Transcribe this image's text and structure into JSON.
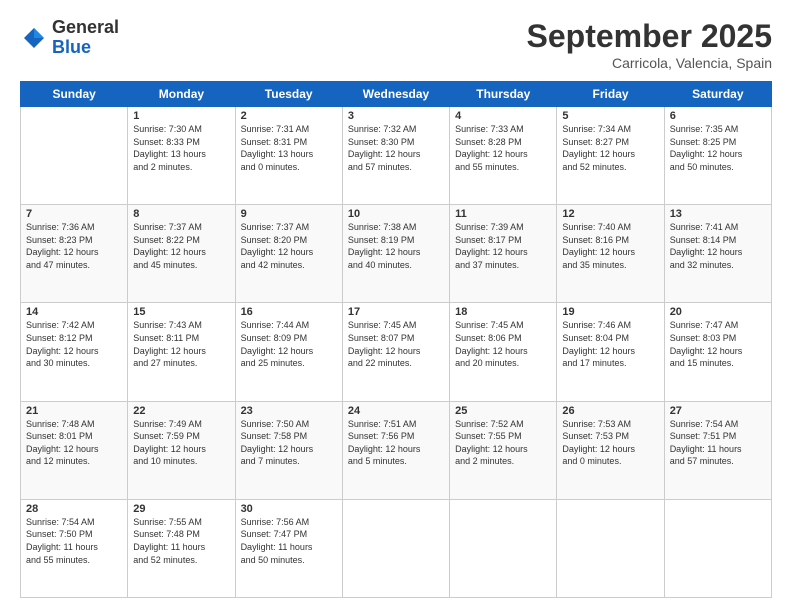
{
  "logo": {
    "general": "General",
    "blue": "Blue"
  },
  "title": "September 2025",
  "location": "Carricola, Valencia, Spain",
  "days_of_week": [
    "Sunday",
    "Monday",
    "Tuesday",
    "Wednesday",
    "Thursday",
    "Friday",
    "Saturday"
  ],
  "weeks": [
    [
      {
        "num": "",
        "info": ""
      },
      {
        "num": "1",
        "info": "Sunrise: 7:30 AM\nSunset: 8:33 PM\nDaylight: 13 hours\nand 2 minutes."
      },
      {
        "num": "2",
        "info": "Sunrise: 7:31 AM\nSunset: 8:31 PM\nDaylight: 13 hours\nand 0 minutes."
      },
      {
        "num": "3",
        "info": "Sunrise: 7:32 AM\nSunset: 8:30 PM\nDaylight: 12 hours\nand 57 minutes."
      },
      {
        "num": "4",
        "info": "Sunrise: 7:33 AM\nSunset: 8:28 PM\nDaylight: 12 hours\nand 55 minutes."
      },
      {
        "num": "5",
        "info": "Sunrise: 7:34 AM\nSunset: 8:27 PM\nDaylight: 12 hours\nand 52 minutes."
      },
      {
        "num": "6",
        "info": "Sunrise: 7:35 AM\nSunset: 8:25 PM\nDaylight: 12 hours\nand 50 minutes."
      }
    ],
    [
      {
        "num": "7",
        "info": "Sunrise: 7:36 AM\nSunset: 8:23 PM\nDaylight: 12 hours\nand 47 minutes."
      },
      {
        "num": "8",
        "info": "Sunrise: 7:37 AM\nSunset: 8:22 PM\nDaylight: 12 hours\nand 45 minutes."
      },
      {
        "num": "9",
        "info": "Sunrise: 7:37 AM\nSunset: 8:20 PM\nDaylight: 12 hours\nand 42 minutes."
      },
      {
        "num": "10",
        "info": "Sunrise: 7:38 AM\nSunset: 8:19 PM\nDaylight: 12 hours\nand 40 minutes."
      },
      {
        "num": "11",
        "info": "Sunrise: 7:39 AM\nSunset: 8:17 PM\nDaylight: 12 hours\nand 37 minutes."
      },
      {
        "num": "12",
        "info": "Sunrise: 7:40 AM\nSunset: 8:16 PM\nDaylight: 12 hours\nand 35 minutes."
      },
      {
        "num": "13",
        "info": "Sunrise: 7:41 AM\nSunset: 8:14 PM\nDaylight: 12 hours\nand 32 minutes."
      }
    ],
    [
      {
        "num": "14",
        "info": "Sunrise: 7:42 AM\nSunset: 8:12 PM\nDaylight: 12 hours\nand 30 minutes."
      },
      {
        "num": "15",
        "info": "Sunrise: 7:43 AM\nSunset: 8:11 PM\nDaylight: 12 hours\nand 27 minutes."
      },
      {
        "num": "16",
        "info": "Sunrise: 7:44 AM\nSunset: 8:09 PM\nDaylight: 12 hours\nand 25 minutes."
      },
      {
        "num": "17",
        "info": "Sunrise: 7:45 AM\nSunset: 8:07 PM\nDaylight: 12 hours\nand 22 minutes."
      },
      {
        "num": "18",
        "info": "Sunrise: 7:45 AM\nSunset: 8:06 PM\nDaylight: 12 hours\nand 20 minutes."
      },
      {
        "num": "19",
        "info": "Sunrise: 7:46 AM\nSunset: 8:04 PM\nDaylight: 12 hours\nand 17 minutes."
      },
      {
        "num": "20",
        "info": "Sunrise: 7:47 AM\nSunset: 8:03 PM\nDaylight: 12 hours\nand 15 minutes."
      }
    ],
    [
      {
        "num": "21",
        "info": "Sunrise: 7:48 AM\nSunset: 8:01 PM\nDaylight: 12 hours\nand 12 minutes."
      },
      {
        "num": "22",
        "info": "Sunrise: 7:49 AM\nSunset: 7:59 PM\nDaylight: 12 hours\nand 10 minutes."
      },
      {
        "num": "23",
        "info": "Sunrise: 7:50 AM\nSunset: 7:58 PM\nDaylight: 12 hours\nand 7 minutes."
      },
      {
        "num": "24",
        "info": "Sunrise: 7:51 AM\nSunset: 7:56 PM\nDaylight: 12 hours\nand 5 minutes."
      },
      {
        "num": "25",
        "info": "Sunrise: 7:52 AM\nSunset: 7:55 PM\nDaylight: 12 hours\nand 2 minutes."
      },
      {
        "num": "26",
        "info": "Sunrise: 7:53 AM\nSunset: 7:53 PM\nDaylight: 12 hours\nand 0 minutes."
      },
      {
        "num": "27",
        "info": "Sunrise: 7:54 AM\nSunset: 7:51 PM\nDaylight: 11 hours\nand 57 minutes."
      }
    ],
    [
      {
        "num": "28",
        "info": "Sunrise: 7:54 AM\nSunset: 7:50 PM\nDaylight: 11 hours\nand 55 minutes."
      },
      {
        "num": "29",
        "info": "Sunrise: 7:55 AM\nSunset: 7:48 PM\nDaylight: 11 hours\nand 52 minutes."
      },
      {
        "num": "30",
        "info": "Sunrise: 7:56 AM\nSunset: 7:47 PM\nDaylight: 11 hours\nand 50 minutes."
      },
      {
        "num": "",
        "info": ""
      },
      {
        "num": "",
        "info": ""
      },
      {
        "num": "",
        "info": ""
      },
      {
        "num": "",
        "info": ""
      }
    ]
  ]
}
